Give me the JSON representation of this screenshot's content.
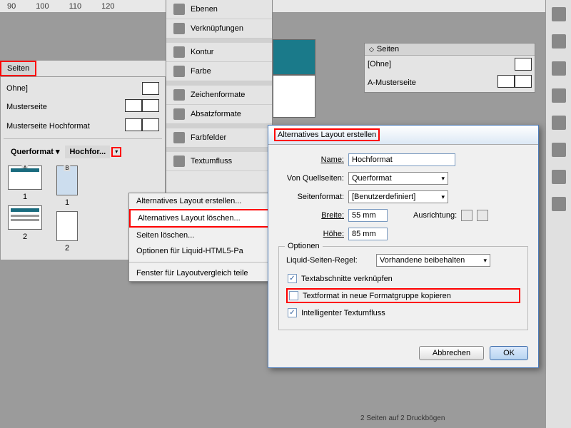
{
  "ruler": {
    "marks": [
      "90",
      "100",
      "110",
      "120"
    ]
  },
  "leftPanel": {
    "tab": "Seiten",
    "masters": [
      "Ohne]",
      "Musterseite",
      "Musterseite Hochformat"
    ],
    "layoutTabs": [
      "Querformat",
      "Hochfor..."
    ],
    "pages": [
      "1",
      "2"
    ]
  },
  "midPanels": {
    "items": [
      "Ebenen",
      "Verknüpfungen",
      "Kontur",
      "Farbe",
      "Zeichenformate",
      "Absatzformate",
      "Farbfelder",
      "Textumfluss"
    ]
  },
  "ctxMenu": {
    "items": [
      "Alternatives Layout erstellen...",
      "Alternatives Layout löschen...",
      "Seiten löschen...",
      "Optionen für Liquid-HTML5-Pa",
      "",
      "Fenster für Layoutvergleich teile"
    ]
  },
  "rightPages": {
    "tab": "Seiten",
    "rows": [
      "[Ohne]",
      "A-Musterseite"
    ]
  },
  "dialog": {
    "title": "Alternatives Layout erstellen",
    "nameLabel": "Name:",
    "nameValue": "Hochformat",
    "srcLabel": "Von Quellseiten:",
    "srcValue": "Querformat",
    "fmtLabel": "Seitenformat:",
    "fmtValue": "[Benutzerdefiniert]",
    "widthLabel": "Breite:",
    "widthValue": "55 mm",
    "heightLabel": "Höhe:",
    "heightValue": "85 mm",
    "orientLabel": "Ausrichtung:",
    "optLegend": "Optionen",
    "liquidLabel": "Liquid-Seiten-Regel:",
    "liquidValue": "Vorhandene beibehalten",
    "chk1": "Textabschnitte verknüpfen",
    "chk2": "Textformat in neue Formatgruppe kopieren",
    "chk3": "Intelligenter Textumfluss",
    "cancel": "Abbrechen",
    "ok": "OK"
  },
  "status": "2 Seiten auf 2 Druckbögen"
}
